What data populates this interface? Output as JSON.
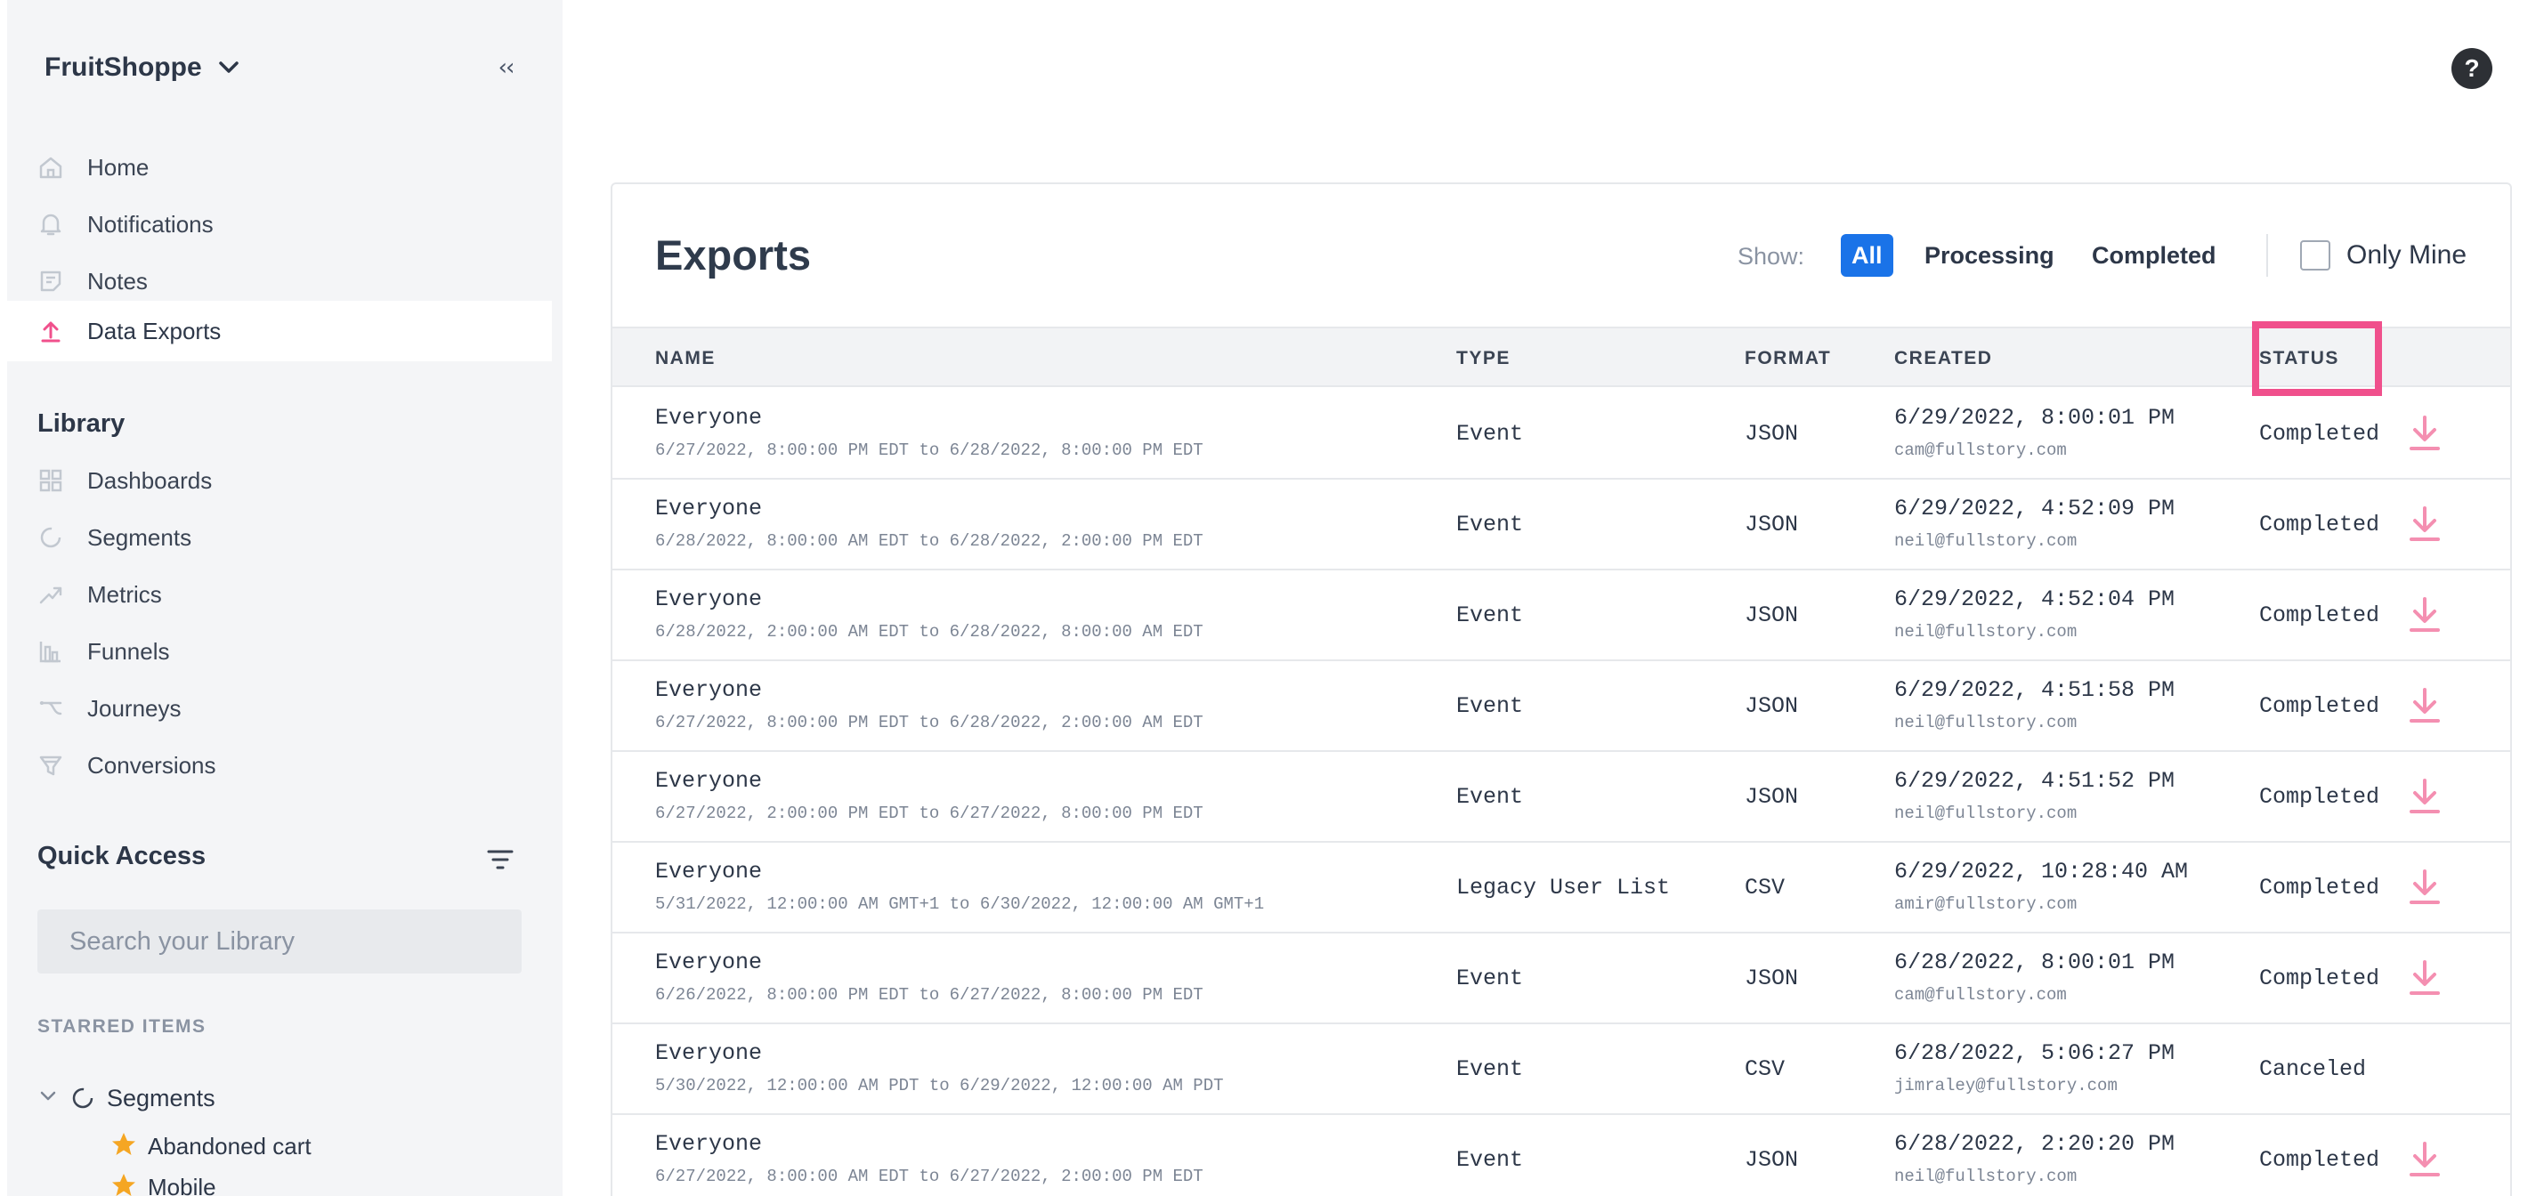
{
  "sidebar": {
    "org_name": "FruitShoppe",
    "collapse_glyph": "‹‹",
    "nav": [
      {
        "label": "Home",
        "icon": "home-icon"
      },
      {
        "label": "Notifications",
        "icon": "bell-icon"
      },
      {
        "label": "Notes",
        "icon": "note-icon"
      },
      {
        "label": "Data Exports",
        "icon": "upload-icon",
        "active": true
      }
    ],
    "library": {
      "title": "Library",
      "items": [
        {
          "label": "Dashboards",
          "icon": "dashboard-icon"
        },
        {
          "label": "Segments",
          "icon": "segment-icon"
        },
        {
          "label": "Metrics",
          "icon": "metrics-icon"
        },
        {
          "label": "Funnels",
          "icon": "funnel-icon"
        },
        {
          "label": "Journeys",
          "icon": "journey-icon"
        },
        {
          "label": "Conversions",
          "icon": "conversion-icon"
        }
      ]
    },
    "quick_access": {
      "title": "Quick Access",
      "search_placeholder": "Search your Library",
      "starred_label": "STARRED ITEMS",
      "tree_group": "Segments",
      "starred": [
        "Abandoned cart",
        "Mobile"
      ]
    }
  },
  "main": {
    "help_label": "?",
    "title": "Exports",
    "show_label": "Show:",
    "filters": [
      "All",
      "Processing",
      "Completed"
    ],
    "selected_filter": "All",
    "only_mine_label": "Only Mine",
    "columns": [
      "NAME",
      "TYPE",
      "FORMAT",
      "CREATED",
      "STATUS"
    ],
    "rows": [
      {
        "name": "Everyone",
        "range": "6/27/2022, 8:00:00 PM EDT to 6/28/2022, 8:00:00 PM EDT",
        "type": "Event",
        "format": "JSON",
        "created": "6/29/2022, 8:00:01 PM",
        "email": "cam@fullstory.com",
        "status": "Completed",
        "downloadable": true
      },
      {
        "name": "Everyone",
        "range": "6/28/2022, 8:00:00 AM EDT to 6/28/2022, 2:00:00 PM EDT",
        "type": "Event",
        "format": "JSON",
        "created": "6/29/2022, 4:52:09 PM",
        "email": "neil@fullstory.com",
        "status": "Completed",
        "downloadable": true
      },
      {
        "name": "Everyone",
        "range": "6/28/2022, 2:00:00 AM EDT to 6/28/2022, 8:00:00 AM EDT",
        "type": "Event",
        "format": "JSON",
        "created": "6/29/2022, 4:52:04 PM",
        "email": "neil@fullstory.com",
        "status": "Completed",
        "downloadable": true
      },
      {
        "name": "Everyone",
        "range": "6/27/2022, 8:00:00 PM EDT to 6/28/2022, 2:00:00 AM EDT",
        "type": "Event",
        "format": "JSON",
        "created": "6/29/2022, 4:51:58 PM",
        "email": "neil@fullstory.com",
        "status": "Completed",
        "downloadable": true
      },
      {
        "name": "Everyone",
        "range": "6/27/2022, 2:00:00 PM EDT to 6/27/2022, 8:00:00 PM EDT",
        "type": "Event",
        "format": "JSON",
        "created": "6/29/2022, 4:51:52 PM",
        "email": "neil@fullstory.com",
        "status": "Completed",
        "downloadable": true
      },
      {
        "name": "Everyone",
        "range": "5/31/2022, 12:00:00 AM GMT+1 to 6/30/2022, 12:00:00 AM GMT+1",
        "type": "Legacy User List",
        "format": "CSV",
        "created": "6/29/2022, 10:28:40 AM",
        "email": "amir@fullstory.com",
        "status": "Completed",
        "downloadable": true
      },
      {
        "name": "Everyone",
        "range": "6/26/2022, 8:00:00 PM EDT to 6/27/2022, 8:00:00 PM EDT",
        "type": "Event",
        "format": "JSON",
        "created": "6/28/2022, 8:00:01 PM",
        "email": "cam@fullstory.com",
        "status": "Completed",
        "downloadable": true
      },
      {
        "name": "Everyone",
        "range": "5/30/2022, 12:00:00 AM PDT to 6/29/2022, 12:00:00 AM PDT",
        "type": "Event",
        "format": "CSV",
        "created": "6/28/2022, 5:06:27 PM",
        "email": "jimraley@fullstory.com",
        "status": "Canceled",
        "downloadable": false
      },
      {
        "name": "Everyone",
        "range": "6/27/2022, 8:00:00 AM EDT to 6/27/2022, 2:00:00 PM EDT",
        "type": "Event",
        "format": "JSON",
        "created": "6/28/2022, 2:20:20 PM",
        "email": "neil@fullstory.com",
        "status": "Completed",
        "downloadable": true
      }
    ]
  },
  "colors": {
    "accent_blue": "#1a73e8",
    "accent_pink": "#f0508c",
    "download_pink": "#f48fb1",
    "star_orange": "#f5a623"
  }
}
